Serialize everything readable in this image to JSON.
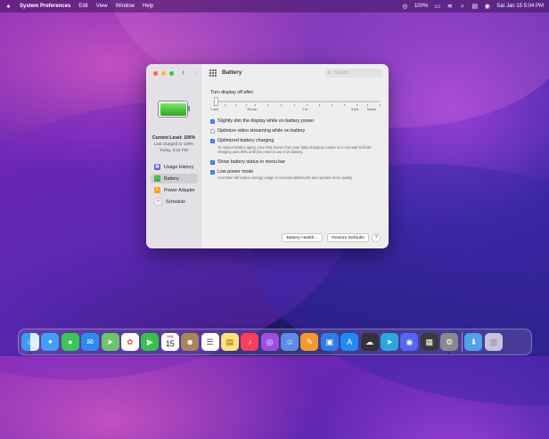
{
  "menubar": {
    "app_name": "System Preferences",
    "menus": [
      "Edit",
      "View",
      "Window",
      "Help"
    ],
    "battery_percent": "100%",
    "datetime": "Sat Jan 15  5:04 PM"
  },
  "window": {
    "title": "Battery",
    "search_placeholder": "Search"
  },
  "sidebar": {
    "current_level": "Current Level: 100%",
    "last_charged": "Last charged to 100%",
    "charged_time": "Today, 5:04 PM",
    "items": [
      {
        "label": "Usage History",
        "icon": "usage-history-icon"
      },
      {
        "label": "Battery",
        "icon": "battery-icon",
        "selected": true
      },
      {
        "label": "Power Adapter",
        "icon": "power-adapter-icon"
      },
      {
        "label": "Schedule",
        "icon": "schedule-icon"
      }
    ]
  },
  "main": {
    "turn_display_off_label": "Turn display off after:",
    "slider_ticks": [
      "1 min",
      "15 min",
      "1 hr",
      "3 hrs",
      "Never"
    ],
    "options": [
      {
        "label": "Slightly dim the display while on battery power",
        "checked": true
      },
      {
        "label": "Optimize video streaming while on battery",
        "checked": false
      },
      {
        "label": "Optimized battery charging",
        "checked": true,
        "description": "To reduce battery aging, your Mac learns from your daily charging routine so it can wait to finish charging past 80% until you need to use it on battery."
      },
      {
        "label": "Show battery status in menu bar",
        "checked": true
      },
      {
        "label": "Low power mode",
        "checked": true,
        "description": "Your Mac will reduce energy usage to increase battery life and operate more quietly."
      }
    ],
    "battery_health_button": "Battery Health...",
    "restore_defaults_button": "Restore Defaults",
    "help_button": "?"
  },
  "dock": {
    "apps": [
      "Finder",
      "Safari",
      "Messages",
      "Mail",
      "Maps",
      "Photos",
      "FaceTime",
      "Calendar",
      "Contacts",
      "Reminders",
      "Notes",
      "Music",
      "Podcasts",
      "Bot",
      "Pages",
      "Keynote",
      "App Store",
      "Terminal",
      "Telegram",
      "Discord",
      "Calculator",
      "System Preferences",
      "Downloads",
      "Trash"
    ],
    "calendar_month": "JAN",
    "calendar_day": "15"
  },
  "colors": {
    "accent": "#2d74e8",
    "battery_green": "#35b33a"
  }
}
